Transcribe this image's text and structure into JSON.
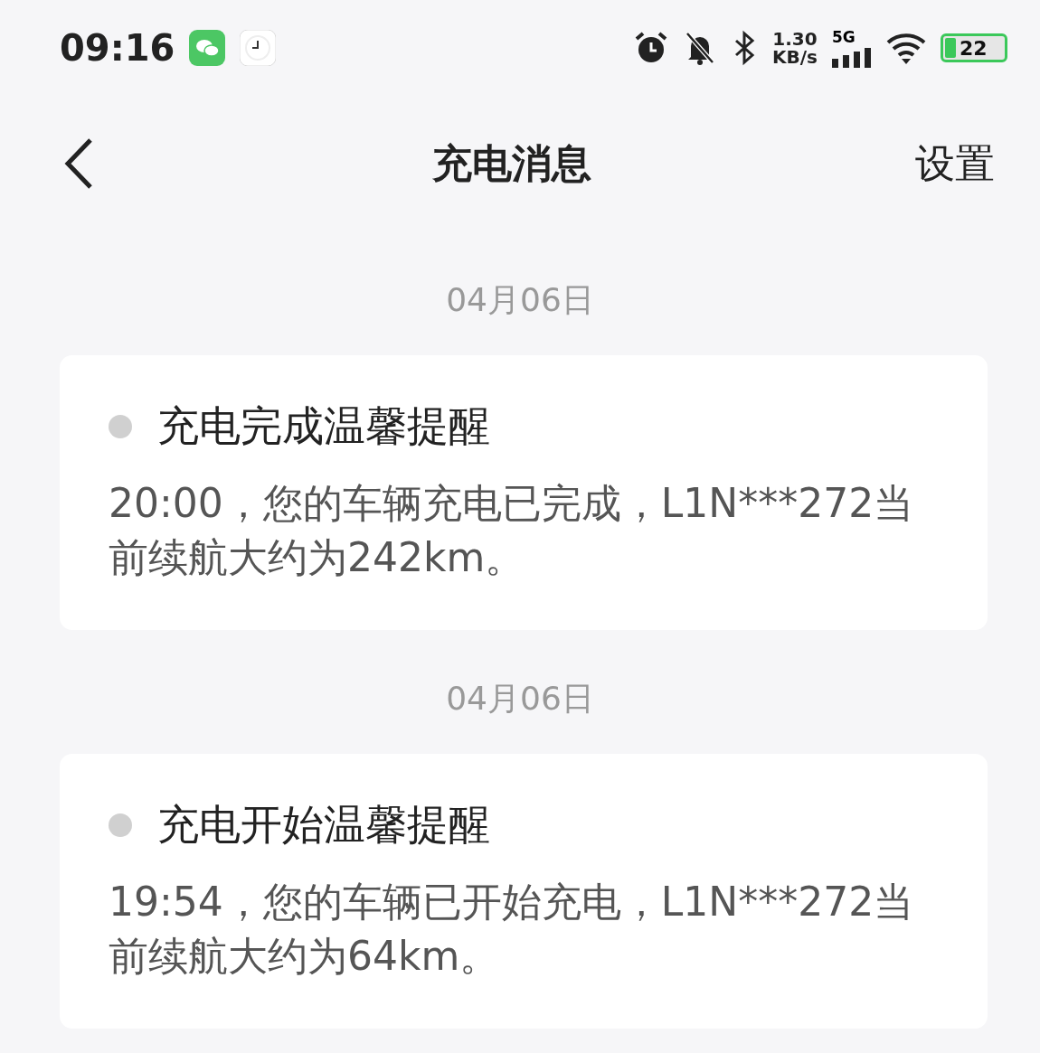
{
  "status_bar": {
    "time": "09:16",
    "network_speed": "1.30",
    "network_unit": "KB/s",
    "network_type": "5G",
    "battery": {
      "text": "22"
    }
  },
  "header": {
    "title": "充电消息",
    "action": "设置"
  },
  "messages": [
    {
      "date": "04月06日",
      "title": "充电完成温馨提醒",
      "body": "20:00，您的车辆充电已完成，L1N***272当前续航大约为242km。"
    },
    {
      "date": "04月06日",
      "title": "充电开始温馨提醒",
      "body": "19:54，您的车辆已开始充电，L1N***272当前续航大约为64km。"
    }
  ]
}
